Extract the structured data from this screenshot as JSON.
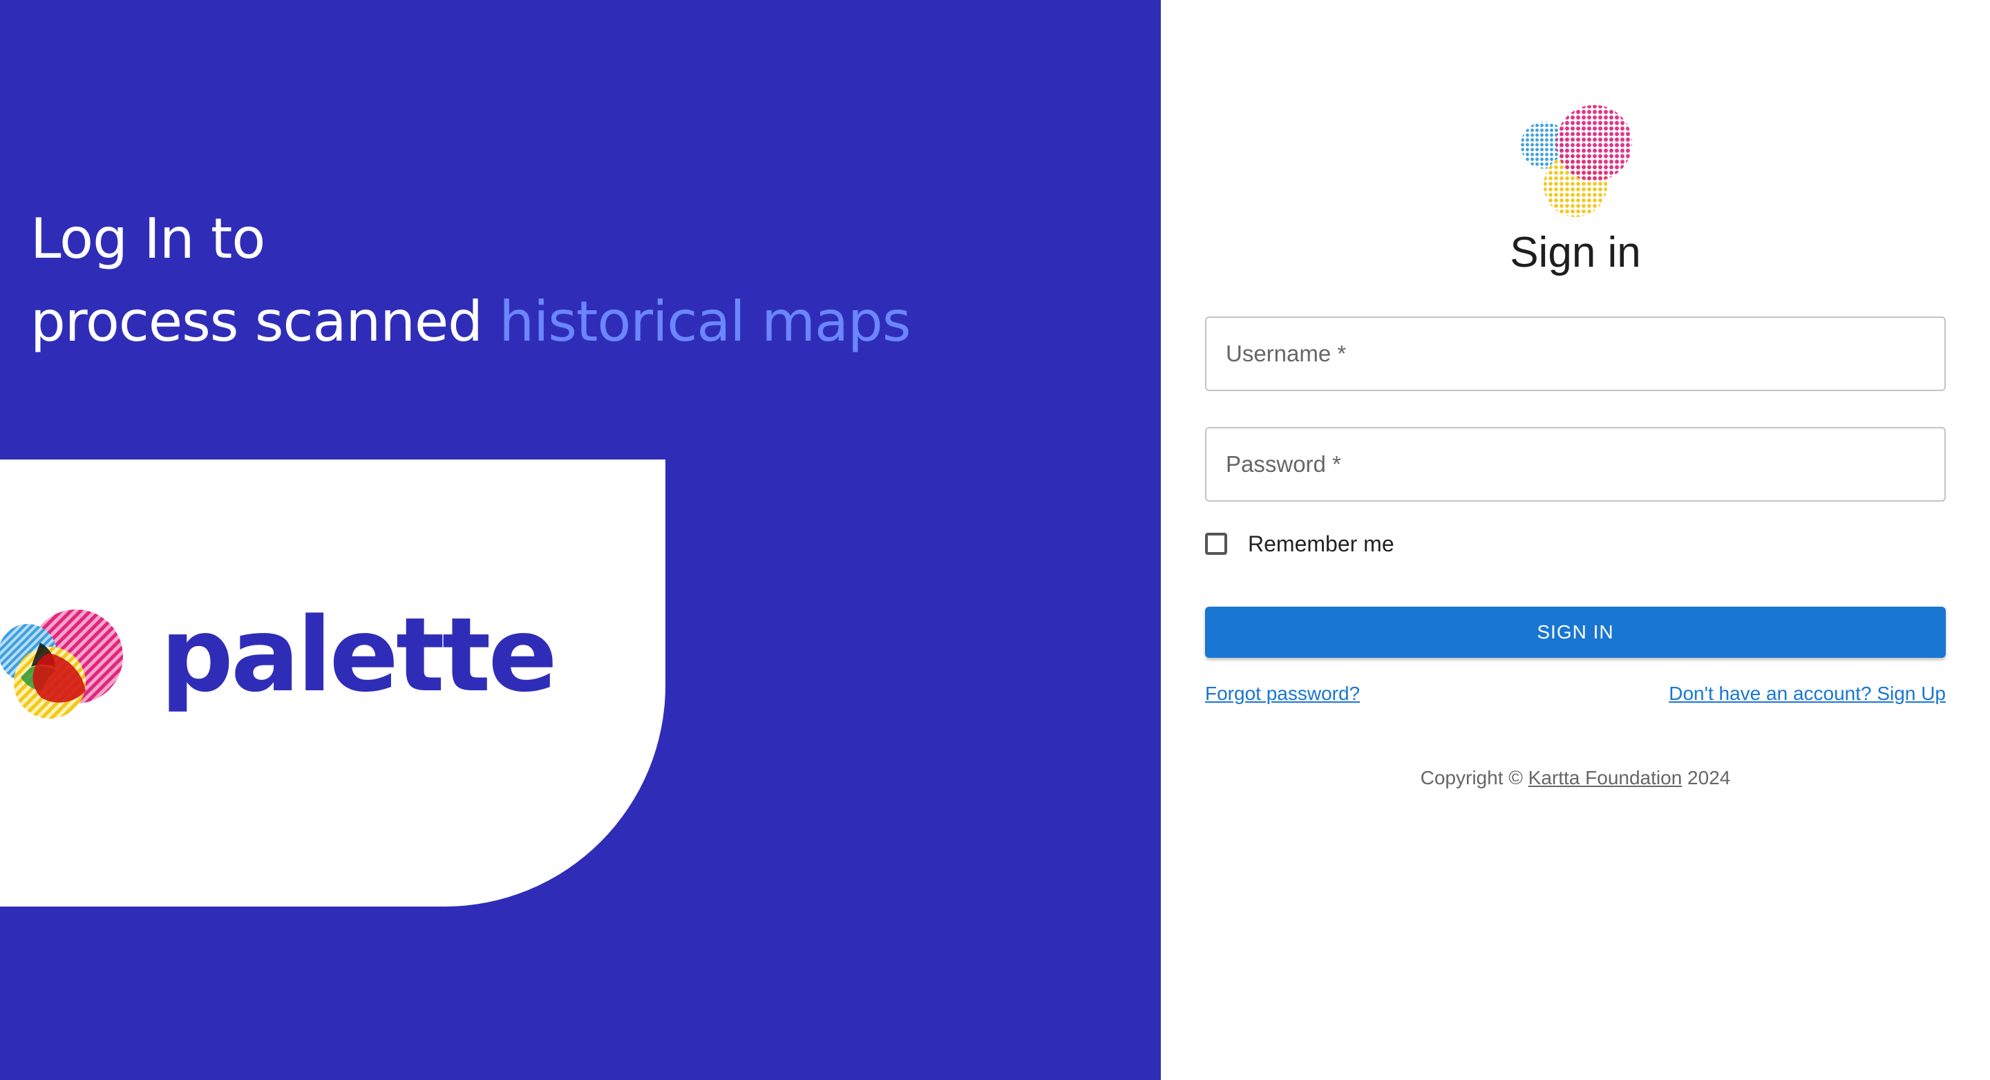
{
  "hero": {
    "line1": "Log In to",
    "line2_prefix": "process scanned ",
    "line2_accent": "historical maps",
    "brand_name": "palette"
  },
  "form": {
    "title": "Sign in",
    "username_placeholder": "Username *",
    "password_placeholder": "Password *",
    "remember_label": "Remember me",
    "submit_label": "SIGN IN",
    "forgot_link": "Forgot password?",
    "signup_link": "Don't have an account? Sign Up"
  },
  "footer": {
    "copyright_prefix": "Copyright © ",
    "org": "Kartta Foundation",
    "year": " 2024"
  },
  "colors": {
    "panel_bg": "#2f2db8",
    "accent_text": "#6b86ff",
    "button": "#1976d2",
    "logo_magenta": "#e0267f",
    "logo_cyan": "#3aa0e0",
    "logo_yellow": "#f2c81c"
  },
  "icons": {
    "logo_mark": "overlapping-circles-logo-icon",
    "checkbox": "checkbox-unchecked-icon"
  }
}
